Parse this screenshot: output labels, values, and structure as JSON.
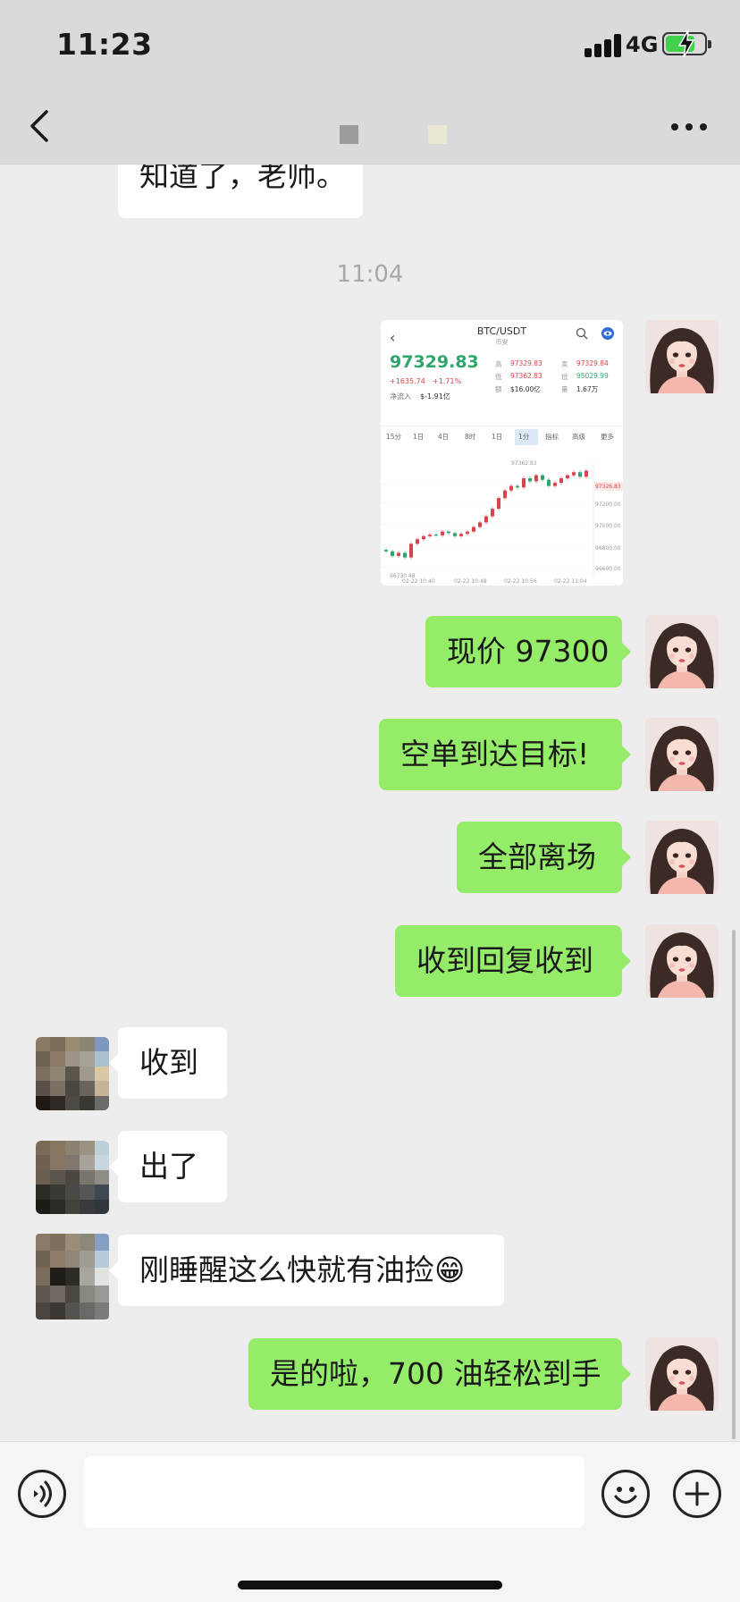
{
  "status_bar": {
    "time": "11:23",
    "network": "4G"
  },
  "nav": {
    "title": ""
  },
  "chat": {
    "partial_message": "知道了，老师。",
    "timestamp": "11:04",
    "screenshot": {
      "pair": "BTC/USDT",
      "subtitle": "币安",
      "price": "97329.83",
      "change": "+1635.74",
      "change_pct": "+1.71%",
      "inflow_label": "净流入",
      "inflow_value": "$-1.91亿",
      "stats": {
        "high_label": "高",
        "high": "97329.83",
        "low_label": "低",
        "low": "97362.83",
        "vol_label": "额",
        "vol": "$16.00亿",
        "ask_label": "卖",
        "ask": "97329.84",
        "bid_label": "低",
        "bid": "95029.99",
        "qty_label": "量",
        "qty": "1.67万"
      },
      "tabs": [
        "15分",
        "1日",
        "4日",
        "8时",
        "1日",
        "1分",
        "指标",
        "高级",
        "更多"
      ],
      "chart_labels": {
        "peak": "97362.83",
        "low": "96730.48",
        "right_ticks": [
          "97326.83",
          "97200.00",
          "97000.00",
          "96800.00",
          "96600.00"
        ],
        "dates": [
          "02-22 10:40",
          "02-22 10:48",
          "02-22 10:56",
          "02-22 11:04"
        ]
      }
    },
    "messages": [
      {
        "side": "out",
        "text": "现价 97300"
      },
      {
        "side": "out",
        "text": "空单到达目标!"
      },
      {
        "side": "out",
        "text": "全部离场"
      },
      {
        "side": "out",
        "text": "收到回复收到"
      },
      {
        "side": "in",
        "text": "收到"
      },
      {
        "side": "in",
        "text": "出了"
      },
      {
        "side": "in",
        "text": "刚睡醒这么快就有油捡😁"
      },
      {
        "side": "out",
        "text": "是的啦，700 油轻松到手"
      }
    ]
  },
  "input": {
    "value": ""
  },
  "colors": {
    "outgoing_bubble": "#95ec69",
    "incoming_bubble": "#ffffff",
    "chat_bg": "#ededed"
  },
  "icons": [
    "back-icon",
    "more-icon",
    "voice-icon",
    "emoji-icon",
    "plus-icon"
  ]
}
